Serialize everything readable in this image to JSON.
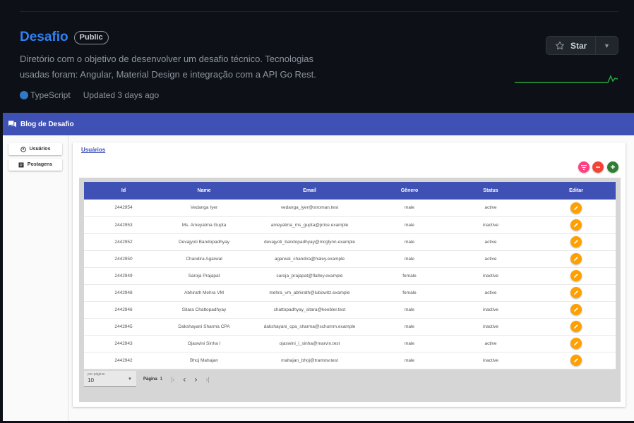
{
  "repo": {
    "name": "Desafio",
    "visibility": "Public",
    "description": "Diretório com o objetivo de desenvolver um desafio técnico. Tecnologias usadas foram: Angular, Material Design e integração com a API Go Rest.",
    "language": "TypeScript",
    "language_color": "#3178c6",
    "updated": "Updated 3 days ago",
    "star_label": "Star"
  },
  "app": {
    "title": "Blog de Desafio",
    "toolbar_color": "#3f51b5",
    "sidebar": [
      {
        "label": "Usuários",
        "icon": "account-icon"
      },
      {
        "label": "Postagens",
        "icon": "post-icon"
      }
    ],
    "breadcrumb": "Usuários",
    "table": {
      "headers": [
        "Id",
        "Name",
        "Email",
        "Gênero",
        "Status",
        "Editar"
      ],
      "rows": [
        {
          "id": "2442954",
          "name": "Vedanga Iyer",
          "email": "vedanga_iyer@stroman.test",
          "gender": "male",
          "status": "active"
        },
        {
          "id": "2442953",
          "name": "Ms. Ameyatma Gupta",
          "email": "ameyatma_ms_gupta@price.example",
          "gender": "male",
          "status": "inactive"
        },
        {
          "id": "2442952",
          "name": "Devajyoti Bandopadhyay",
          "email": "devajyoti_bandopadhyay@mcglynn.example",
          "gender": "male",
          "status": "active"
        },
        {
          "id": "2442950",
          "name": "Chandira Agarwal",
          "email": "agarwal_chandira@haley.example",
          "gender": "male",
          "status": "active"
        },
        {
          "id": "2442949",
          "name": "Saroja Prajapat",
          "email": "saroja_prajapat@flatley.example",
          "gender": "female",
          "status": "inactive"
        },
        {
          "id": "2442948",
          "name": "Abhirath Mehra VM",
          "email": "mehra_vm_abhirath@lubowitz.example",
          "gender": "female",
          "status": "active"
        },
        {
          "id": "2442946",
          "name": "Sitara Chattopadhyay",
          "email": "chattopadhyay_sitara@keebler.test",
          "gender": "male",
          "status": "inactive"
        },
        {
          "id": "2442945",
          "name": "Dakshayani Sharma CPA",
          "email": "dakshayani_cpa_sharma@schumm.example",
          "gender": "male",
          "status": "inactive"
        },
        {
          "id": "2442943",
          "name": "Ojaswini Sinha I",
          "email": "ojaswini_i_sinha@marvin.test",
          "gender": "male",
          "status": "active"
        },
        {
          "id": "2442942",
          "name": "Bhoj Mahajan",
          "email": "mahajan_bhoj@trantow.test",
          "gender": "male",
          "status": "inactive"
        }
      ]
    },
    "paginator": {
      "per_page_label": "por página:",
      "per_page_value": "10",
      "page_label": "Página",
      "page_number": "1"
    }
  }
}
